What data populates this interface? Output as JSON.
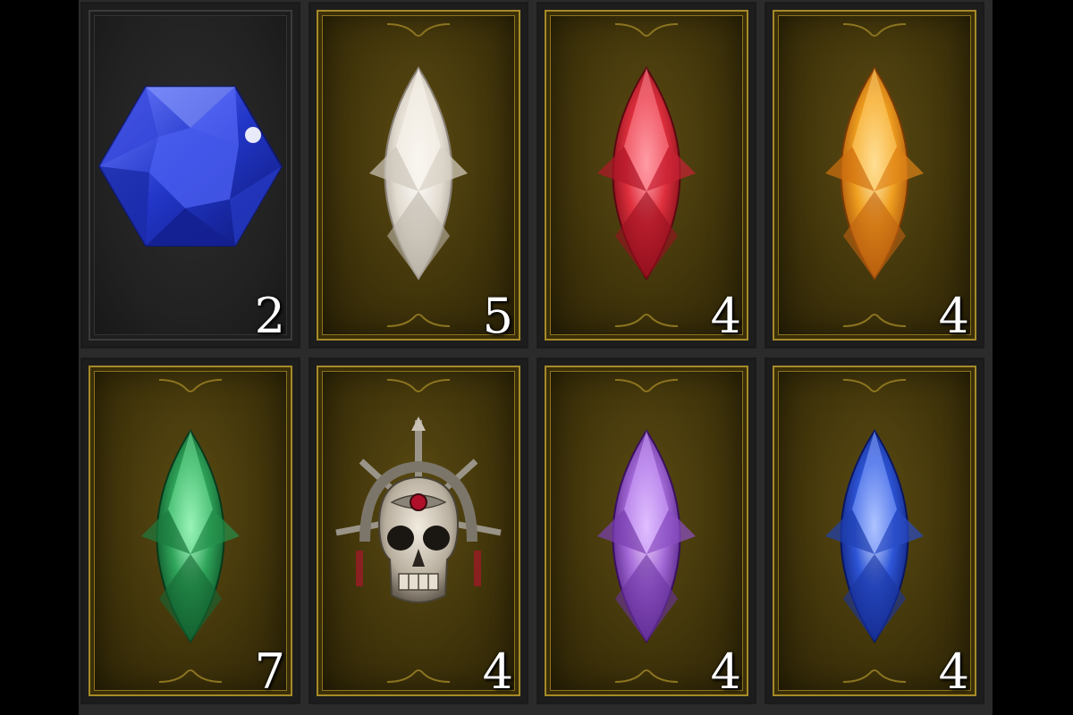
{
  "inventory": {
    "slots": [
      {
        "item_icon": "sapphire-hexagon-gem-icon",
        "count": "2",
        "frame": "dark",
        "color": "#2a3fd0"
      },
      {
        "item_icon": "diamond-marquise-gem-icon",
        "count": "5",
        "frame": "gold",
        "color": "#e8e2d8"
      },
      {
        "item_icon": "ruby-marquise-gem-icon",
        "count": "4",
        "frame": "gold",
        "color": "#d42a3a"
      },
      {
        "item_icon": "topaz-marquise-gem-icon",
        "count": "4",
        "frame": "gold",
        "color": "#f0a020"
      },
      {
        "item_icon": "emerald-marquise-gem-icon",
        "count": "7",
        "frame": "gold",
        "color": "#2fa45a"
      },
      {
        "item_icon": "skull-crowned-gem-icon",
        "count": "4",
        "frame": "gold",
        "color": "#cfc6b8"
      },
      {
        "item_icon": "amethyst-marquise-gem-icon",
        "count": "4",
        "frame": "gold",
        "color": "#a46ad8"
      },
      {
        "item_icon": "sapphire-marquise-gem-icon",
        "count": "4",
        "frame": "gold",
        "color": "#2e56d8"
      }
    ]
  }
}
